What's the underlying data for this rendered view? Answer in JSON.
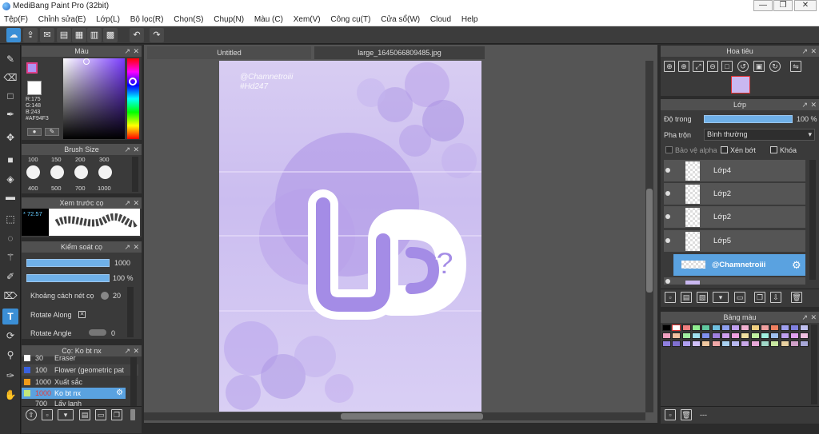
{
  "app": {
    "title": "MediBang Paint Pro (32bit)"
  },
  "window_buttons": [
    "—",
    "❐",
    "✕"
  ],
  "menu": [
    "Tệp(F)",
    "Chỉnh sửa(E)",
    "Lớp(L)",
    "Bộ lọc(R)",
    "Chọn(S)",
    "Chụp(N)",
    "Màu (C)",
    "Xem(V)",
    "Công cụ(T)",
    "Cửa sổ(W)",
    "Cloud",
    "Help"
  ],
  "toolbar": {
    "icons": [
      "cloud-icon",
      "share-icon",
      "chat-icon",
      "page-icon",
      "document-icon",
      "grid-icon",
      "tiles-icon",
      "undo-icon",
      "redo-icon"
    ]
  },
  "color_panel": {
    "title": "Màu",
    "r": "R:175",
    "g": "G:148",
    "b": "B:243",
    "hex": "#AF94F3",
    "fg": "#AF94F3",
    "bg": "#FFFFFF"
  },
  "brush_size_panel": {
    "title": "Brush Size",
    "sizes_row1": [
      "100",
      "150",
      "200",
      "300"
    ],
    "sizes_row2": [
      "400",
      "500",
      "700",
      "1000"
    ]
  },
  "brush_preview_panel": {
    "title": "Xem trước cọ",
    "value": "* 72.57"
  },
  "brush_control_panel": {
    "title": "Kiểm soát cọ",
    "size_value": "1000",
    "opacity_value": "100 %",
    "spacing_label": "Khoảng cách nét cọ",
    "spacing_value": "20",
    "rotate_along_label": "Rotate Along",
    "rotate_angle_label": "Rotate Angle",
    "rotate_angle_value": "0"
  },
  "brush_list_panel": {
    "title": "Cọ: Ko bt nx",
    "items": [
      {
        "size": "30",
        "name": "Eraser",
        "color": "#ffffff"
      },
      {
        "size": "100",
        "name": "Flower (geometric pat",
        "color": "#3a62e0"
      },
      {
        "size": "1000",
        "name": "Xuất sắc",
        "color": "#f09a1a"
      },
      {
        "size": "1000",
        "name": "Ko bt nx",
        "color": "#c4e87a"
      },
      {
        "size": "700",
        "name": "Lấy lạnh",
        "color": "#555"
      }
    ]
  },
  "document_tabs": [
    "Untitled",
    "large_1645066809485.jpg"
  ],
  "artwork": {
    "watermark_line1": "@Chamnetroiii",
    "watermark_line2": "#Hd247",
    "main_text": "Ưa",
    "question_mark": "?"
  },
  "navigator_panel": {
    "title": "Hoa tiêu"
  },
  "layer_panel": {
    "title": "Lớp",
    "opacity_label": "Độ trong",
    "opacity_value": "100 %",
    "opacity_fraction": 0.93,
    "blend_label": "Pha trộn",
    "blend_value": "Bình thường",
    "protect_alpha": "Bảo vệ alpha",
    "clipping": "Xén bớt",
    "lock": "Khóa",
    "layers": [
      "Lớp4",
      "Lớp2",
      "Lớp2",
      "Lớp5",
      "@Chamnetroiii"
    ]
  },
  "palette_panel": {
    "title": "Bảng màu",
    "bottom_text": "---",
    "rows": [
      [
        "#000000",
        "#ffffff",
        "#f08080",
        "#90ee90",
        "#60c8a0",
        "#70c0e0",
        "#8fa0f0",
        "#c0a0f0",
        "#f0b0d0",
        "#f0d080",
        "#f0a0a0",
        "#f08060",
        "#a0a0f0",
        "#8080e0",
        "#c0c0f0"
      ],
      [
        "#f0a0c0",
        "#f0c0a0",
        "#a0f0a0",
        "#a0e0f0",
        "#8090f0",
        "#a080e0",
        "#d0a0f0",
        "#f0a0e0",
        "#f0e0a0",
        "#c0f0a0",
        "#a0f0e0",
        "#a0c0f0",
        "#c0a0f0",
        "#e0a0f0",
        "#f0c0e0"
      ],
      [
        "#9080e0",
        "#8070d0",
        "#b0a0f0",
        "#d0c0f8",
        "#f0c8a0",
        "#f0a8a8",
        "#a8d0f0",
        "#b8b8f0",
        "#c8a8e8",
        "#e8a8d8",
        "#a0d8c8",
        "#c8e8a0",
        "#e8d0a0",
        "#d0a0c8",
        "#a8a8d8"
      ]
    ]
  }
}
